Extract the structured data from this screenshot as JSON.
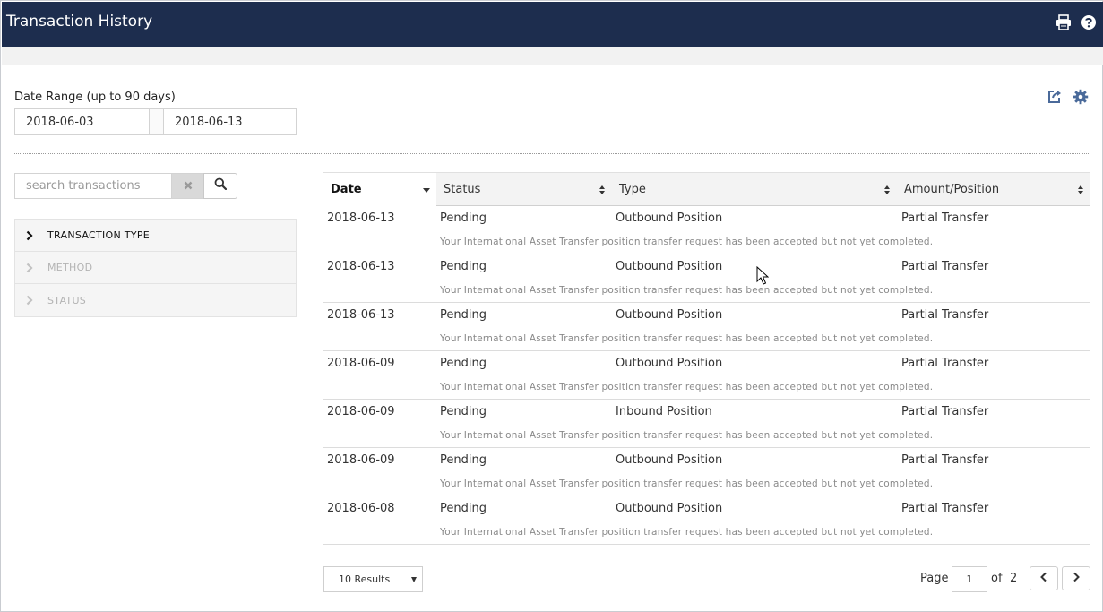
{
  "header": {
    "title": "Transaction History",
    "icons": [
      "print-icon",
      "help-icon"
    ]
  },
  "date_range": {
    "label": "Date Range (up to 90 days)",
    "from": "2018-06-03",
    "to": "2018-06-13"
  },
  "toolbar_icons": [
    "export-icon",
    "gear-icon"
  ],
  "search": {
    "placeholder": "search transactions",
    "value": ""
  },
  "filters": [
    {
      "label": "TRANSACTION TYPE",
      "active": true
    },
    {
      "label": "METHOD",
      "active": false
    },
    {
      "label": "STATUS",
      "active": false
    }
  ],
  "table": {
    "columns": [
      "Date",
      "Status",
      "Type",
      "Amount/Position"
    ],
    "sorted_column": "Date",
    "rows": [
      {
        "date": "2018-06-13",
        "status": "Pending",
        "type": "Outbound Position",
        "amount": "Partial Transfer",
        "description": "Your International Asset Transfer position transfer request has been accepted but not yet completed."
      },
      {
        "date": "2018-06-13",
        "status": "Pending",
        "type": "Outbound Position",
        "amount": "Partial Transfer",
        "description": "Your International Asset Transfer position transfer request has been accepted but not yet completed."
      },
      {
        "date": "2018-06-13",
        "status": "Pending",
        "type": "Outbound Position",
        "amount": "Partial Transfer",
        "description": "Your International Asset Transfer position transfer request has been accepted but not yet completed."
      },
      {
        "date": "2018-06-09",
        "status": "Pending",
        "type": "Outbound Position",
        "amount": "Partial Transfer",
        "description": "Your International Asset Transfer position transfer request has been accepted but not yet completed."
      },
      {
        "date": "2018-06-09",
        "status": "Pending",
        "type": "Inbound Position",
        "amount": "Partial Transfer",
        "description": "Your International Asset Transfer position transfer request has been accepted but not yet completed."
      },
      {
        "date": "2018-06-09",
        "status": "Pending",
        "type": "Outbound Position",
        "amount": "Partial Transfer",
        "description": "Your International Asset Transfer position transfer request has been accepted but not yet completed."
      },
      {
        "date": "2018-06-08",
        "status": "Pending",
        "type": "Outbound Position",
        "amount": "Partial Transfer",
        "description": "Your International Asset Transfer position transfer request has been accepted but not yet completed."
      }
    ]
  },
  "pagination": {
    "results_label": "10 Results",
    "page_label": "Page",
    "current_page": "1",
    "of_label": "of",
    "total_pages": "2"
  },
  "colors": {
    "header_bg": "#1d2d4e",
    "icon_blue": "#4a6a9a"
  }
}
